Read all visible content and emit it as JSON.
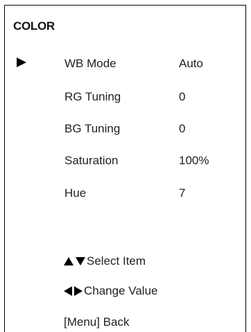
{
  "menu": {
    "title": "COLOR",
    "cursor_icon": "right-triangle-icon",
    "selected_index": 0,
    "items": [
      {
        "label": "WB Mode",
        "value": "Auto"
      },
      {
        "label": "RG Tuning",
        "value": "0"
      },
      {
        "label": "BG Tuning",
        "value": "0"
      },
      {
        "label": "Saturation",
        "value": "100%"
      },
      {
        "label": "Hue",
        "value": "7"
      }
    ]
  },
  "hints": {
    "select": {
      "icons": [
        "up-arrow-icon",
        "down-arrow-icon"
      ],
      "text": "Select Item"
    },
    "change": {
      "icons": [
        "left-arrow-icon",
        "right-arrow-icon"
      ],
      "text": "Change Value"
    },
    "back": {
      "text": "[Menu] Back"
    }
  },
  "colors": {
    "background": "#ffffff",
    "text": "#222222",
    "border": "#000000"
  }
}
